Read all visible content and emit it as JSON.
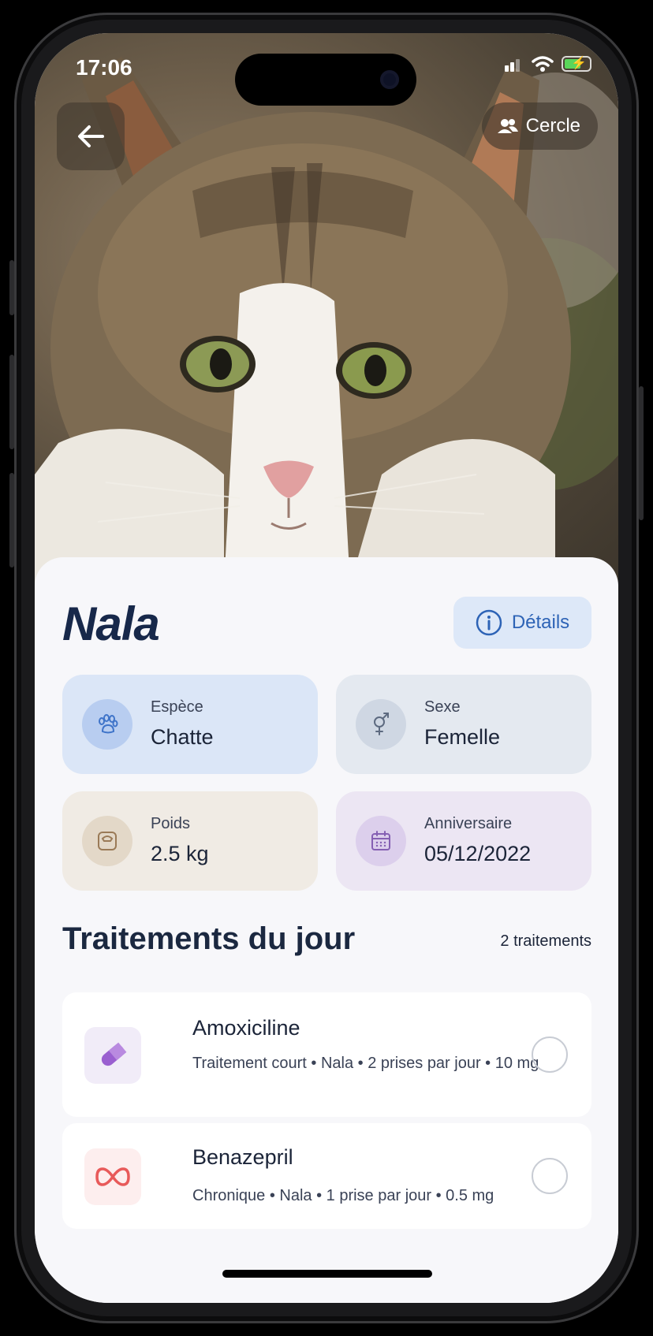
{
  "status_bar": {
    "time": "17:06"
  },
  "header": {
    "back_label": "←",
    "circle_button": "Cercle"
  },
  "pet": {
    "name": "Nala",
    "details_button": "Détails"
  },
  "info_cards": [
    {
      "label": "Espèce",
      "value": "Chatte",
      "icon": "paw-icon",
      "bg": "#dbe6f7",
      "circle": "#b8cdf0",
      "accent": "#3f74c9"
    },
    {
      "label": "Sexe",
      "value": "Femelle",
      "icon": "gender-icon",
      "bg": "#e4e9f0",
      "circle": "#cfd7e3",
      "accent": "#5d6a80"
    },
    {
      "label": "Poids",
      "value": "2.5 kg",
      "icon": "scale-icon",
      "bg": "#f0ebe4",
      "circle": "#e3d8c8",
      "accent": "#9a7a57"
    },
    {
      "label": "Anniversaire",
      "value": "05/12/2022",
      "icon": "calendar-icon",
      "bg": "#ece6f3",
      "circle": "#dccfec",
      "accent": "#8560b3"
    }
  ],
  "treatments": {
    "title": "Traitements du jour",
    "count": "2 traitements",
    "items": [
      {
        "name": "Amoxiciline",
        "description": "Traitement court • Nala • 2 prises par jour • 10 mg",
        "icon": "pill-icon",
        "icon_bg": "#f1ecf8",
        "icon_color": "#9a5fd0"
      },
      {
        "name": "Benazepril",
        "description": "Chronique • Nala • 1 prise par jour • 0.5 mg",
        "icon": "infinity-icon",
        "icon_bg": "#fdeeee",
        "icon_color": "#e85a5a"
      }
    ]
  }
}
